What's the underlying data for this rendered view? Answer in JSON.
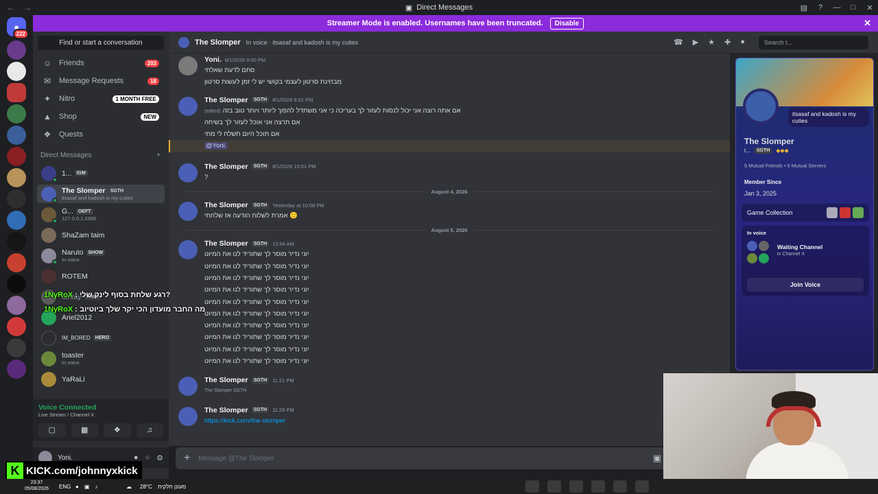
{
  "window": {
    "title": "Direct Messages"
  },
  "banner": {
    "text": "Streamer Mode is enabled. Usernames have been truncated.",
    "button": "Disable"
  },
  "rail": {
    "home_badge": "222",
    "servers": [
      "SVR",
      "The Agents"
    ]
  },
  "sidebar": {
    "find_placeholder": "Find or start a conversation",
    "links": [
      {
        "label": "Friends",
        "badge": "203",
        "icon": "friends-icon"
      },
      {
        "label": "Message Requests",
        "badge": "18",
        "icon": "mail-icon"
      },
      {
        "label": "Nitro",
        "badge": "1 MONTH FREE",
        "icon": "nitro-icon"
      },
      {
        "label": "Shop",
        "badge": "NEW",
        "icon": "shop-icon"
      },
      {
        "label": "Quests",
        "badge": "",
        "icon": "quests-icon"
      }
    ],
    "dm_header": "Direct Messages",
    "dms": [
      {
        "name": "1...",
        "tag": "IGM",
        "sub": ""
      },
      {
        "name": "The Slomper",
        "tag": "SGTH",
        "sub": "itsasaf and kadosh is my cuties"
      },
      {
        "name": "G...",
        "tag": "OEFT",
        "sub": "127.0.0.1:3389"
      },
      {
        "name": "ShaZam taim",
        "tag": "",
        "sub": ""
      },
      {
        "name": "Naruto",
        "tag": "SHOW",
        "sub": "In voice"
      },
      {
        "name": "ROTEM",
        "tag": "",
        "sub": ""
      },
      {
        "name": "turitay",
        "tag": "Wave",
        "sub": ""
      },
      {
        "name": "Ariel2012",
        "tag": "",
        "sub": ""
      },
      {
        "name": "IM_BORED",
        "tag": "HERO",
        "sub": ""
      },
      {
        "name": "toaster",
        "tag": "",
        "sub": "In voice"
      },
      {
        "name": "YaRaLi",
        "tag": "",
        "sub": ""
      }
    ],
    "voice": {
      "status": "Voice Connected",
      "channel": "Live Stream / Channel X"
    },
    "user": {
      "name": "Yoni."
    }
  },
  "chat": {
    "header": {
      "name": "The Slomper",
      "status": "In voice · itsasaf and kadosh is my cuties",
      "search": "Search t..."
    },
    "messages": [
      {
        "author": "Yoni.",
        "time": "8/1/2026 9:00 PM",
        "lines": [
          "סתם לדעת שאלתי",
          "מבחינת סרטון לעצמי בקושי יש לי זמן לעשות סרטון"
        ]
      },
      {
        "author": "The Slomper",
        "tag": "SGTH",
        "time": "8/1/2026 9:01 PM",
        "edited": "(edited)",
        "lines": [
          "אם אתה רוצה אני יכול לנסות לעזור לך בעריכה כי אני משתדל להפוך ליותר ויותר טוב בזה",
          "אם תרצה אני אוכל לעזור לך בשיחה",
          "אם תוכל היום תשלח לי מתי"
        ],
        "mention": "@Yoni."
      },
      {
        "author": "The Slomper",
        "tag": "SGTH",
        "time": "8/1/2026 10:51 PM",
        "lines": [
          "?"
        ]
      },
      {
        "divider": "August 4, 2026"
      },
      {
        "author": "The Slomper",
        "tag": "SGTH",
        "time": "Yesterday at 10:08 PM",
        "lines": [
          "אמרת לשלוח הודעה אז שלחתי 🙂"
        ]
      },
      {
        "divider": "August 5, 2026"
      },
      {
        "author": "The Slomper",
        "tag": "SGTH",
        "time": "12:54 AM",
        "lines": [
          "יוני נדיר מוסר לך שתוריד לנו את המיוט",
          "יוני נדיר מוסר לך שתוריד לנו את המיוט",
          "יוני נדיר מוסר לך שתוריד לנו את המיוט",
          "יוני נדיר מוסר לך שתוריד לנו את המיוט",
          "יוני נדיר מוסר לך שתוריד לנו את המיוט",
          "יוני נדיר מוסר לך שתוריד לנו את המיוט",
          "יוני נדיר מוסר לך שתוריד לנו את המיוט",
          "יוני נדיר מוסר לך שתוריד לנו את המיוט",
          "יוני נדיר מוסר לך שתוריד לנו את המיוט",
          "יוני נדיר מוסר לך שתוריד לנו את המיוט"
        ]
      },
      {
        "author": "The Slomper",
        "tag": "SGTH",
        "time": "11:21 PM",
        "lines": [
          "The Slomper SGTH"
        ]
      },
      {
        "author": "The Slomper",
        "tag": "SGTH",
        "time": "11:29 PM",
        "link": "https://kick.com/the-slomper"
      }
    ],
    "composer_placeholder": "Message @The Slomper"
  },
  "profile": {
    "bubble": "itsasaf and kadosh is my cuties",
    "name": "The Slomper",
    "tag": "t...",
    "guild_tag": "SGTH",
    "mutual": "5 Mutual Friends • 5 Mutual Servers",
    "member_since_label": "Member Since",
    "member_since": "Jan 3, 2025",
    "game_collection": "Game Collection",
    "in_voice": "In voice",
    "voice_channel": "Waiting Channel",
    "voice_server": "in Channel X",
    "join_button": "Join Voice"
  },
  "overlay": {
    "chat_lines": [
      {
        "user": "1NyRoX",
        "text": "רגע שלחת בסוף לינק שלי?"
      },
      {
        "user": "1NyRoX",
        "text": "מה החבר מועדון הכי יקר שלך ביוטיוב"
      }
    ],
    "kick": "KICK.com/johnnyxkick"
  },
  "taskbar": {
    "time": "23:37",
    "date": "05/08/2026",
    "lang": "ENG",
    "weather": "28°C",
    "weather_text": "מעונן חלקית"
  },
  "colors": {
    "accent": "#5865f2",
    "banner": "#8c2bdb",
    "online": "#23a55a",
    "danger": "#f23f43",
    "kick": "#53fc18"
  }
}
